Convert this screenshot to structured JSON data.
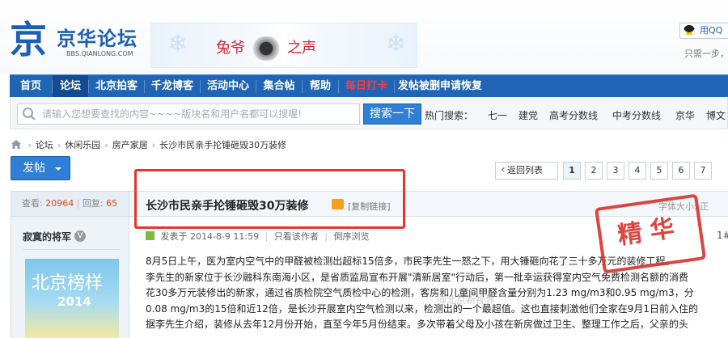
{
  "header": {
    "logo_mark": "京",
    "logo_text": "京华论坛",
    "logo_sub": "BBS.QIANLONG.COM",
    "banner_left": "兔爷",
    "banner_right": "之声",
    "banner_small": "每日播报",
    "qq_login": "用QQ",
    "note": "只需一步，"
  },
  "nav": {
    "items": [
      "首页",
      "论坛",
      "北京拍客",
      "千龙博客",
      "活动中心",
      "集合帖",
      "帮助",
      "每日打卡",
      "发帖被删申请恢复"
    ],
    "active_index": 1,
    "hot_index": 7
  },
  "search": {
    "placeholder": "请输入您想要查找的内容~~~~版块名和用户名都可以搜喔!",
    "button": "搜索一下",
    "hot_label": "热门搜索：",
    "hot_terms": [
      "七一",
      "建党",
      "高考分数线",
      "中考分数线",
      "京华",
      "博文"
    ]
  },
  "breadcrumb": [
    "论坛",
    "休闲乐园",
    "房产家居",
    "长沙市民亲手抡锤砸毁30万装修"
  ],
  "toolbar": {
    "post_button": "发帖",
    "back_to_list": "返回列表",
    "pages": [
      "1",
      "2",
      "3",
      "4",
      "5",
      "6",
      "7"
    ],
    "current_page": "1"
  },
  "thread": {
    "views_label": "查看:",
    "views": "20964",
    "replies_label": "回复:",
    "replies": "65",
    "title": "长沙市民亲手抡锤砸毁30万装修",
    "copy_link": "[复制链接]",
    "font_size_label": "字体大小: 正",
    "stamp": "精华"
  },
  "post": {
    "author": "寂寞的将军",
    "author_badge": "V",
    "avatar_text": "北京榜样",
    "avatar_year": "2014",
    "posted": "发表于 2014-8-9 11:59",
    "only_author": "只看该作者",
    "reverse": "倒序浏览",
    "floor": "1#",
    "body": [
      "8月5日上午，医为室内空气中的甲醛被检测出超标15倍多，市民李先生一怒之下，用大锤砸向花了三十多万元的装修工程。",
      "李先生的新家位于长沙融科东南海小区，是省质监局宣布开展\"清新居室\"行动后，第一批幸运获得室内空气免费检测名额的消费",
      "花30多万元装修出的新家，通过省质检院空气质检中心的检测，客房和儿童间甲醛含量分别为1.23 mg/m3和0.95 mg/m3，分",
      "0.08 mg/m3的15倍和近12倍，是长沙开展室内空气检测以来，检测出的一个最超值。这也直接刺激他们全家在9月1日前入住的",
      "据李先生介绍，装修从去年12月份开始，直至今年5月份结束。多次带着父母及小孩在新房做过卫生、整理工作之后，父亲的头"
    ],
    "watermark": "@北京新视界"
  },
  "colors": {
    "nav_bg": "#1f64b5",
    "accent_red": "#e8352c",
    "button_blue": "#2f7fd6"
  }
}
